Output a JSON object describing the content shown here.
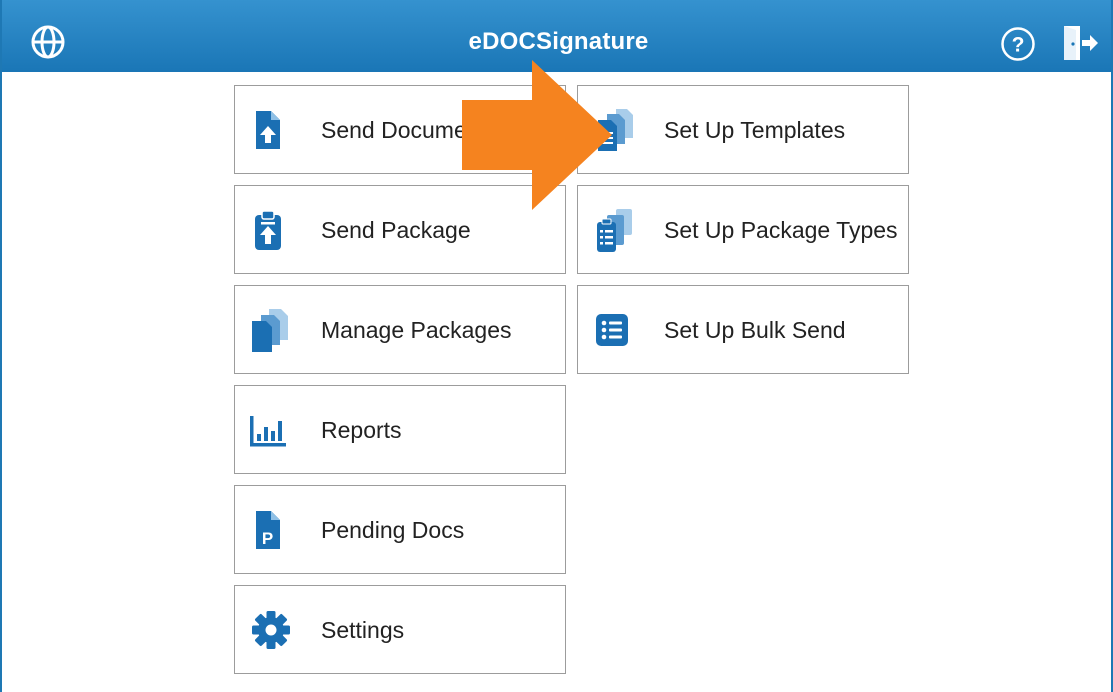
{
  "header": {
    "title": "eDOCSignature",
    "globe_icon": "globe-icon",
    "help_icon": "help-icon",
    "logout_icon": "logout-icon"
  },
  "left_menu": [
    {
      "label": "Send Document",
      "icon": "upload-document-icon"
    },
    {
      "label": "Send Package",
      "icon": "clipboard-upload-icon"
    },
    {
      "label": "Manage Packages",
      "icon": "stacked-documents-icon"
    },
    {
      "label": "Reports",
      "icon": "bar-chart-icon"
    },
    {
      "label": "Pending Docs",
      "icon": "pending-document-icon"
    },
    {
      "label": "Settings",
      "icon": "gear-icon"
    }
  ],
  "right_menu": [
    {
      "label": "Set Up Templates",
      "icon": "templates-icon"
    },
    {
      "label": "Set Up Package Types",
      "icon": "package-types-icon"
    },
    {
      "label": "Set Up Bulk Send",
      "icon": "list-icon"
    }
  ],
  "colors": {
    "header_blue": "#1a76b6",
    "icon_blue": "#1b6fb3",
    "annotation_orange": "#f5831f"
  }
}
